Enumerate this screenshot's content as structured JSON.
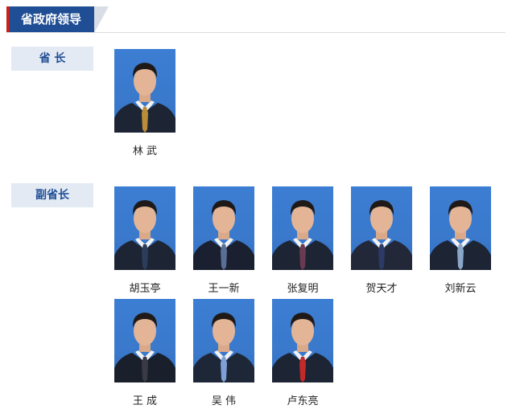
{
  "header": {
    "title": "省政府领导"
  },
  "sections": [
    {
      "label": "省 长"
    },
    {
      "label": "副省长"
    }
  ],
  "people": [
    {
      "name": "林 武",
      "tie": "#b98d3a",
      "suit": "#1d2433"
    },
    {
      "name": "胡玉亭",
      "tie": "#2c3d5c",
      "suit": "#1d2433"
    },
    {
      "name": "王一新",
      "tie": "#5a6f96",
      "suit": "#1a2030"
    },
    {
      "name": "张复明",
      "tie": "#6a3a50",
      "suit": "#1d2433"
    },
    {
      "name": "贺天才",
      "tie": "#2b3a66",
      "suit": "#222838"
    },
    {
      "name": "刘新云",
      "tie": "#8aa6c8",
      "suit": "#1d2433"
    },
    {
      "name": "王 成",
      "tie": "#3a3a44",
      "suit": "#1a1f2c"
    },
    {
      "name": "吴 伟",
      "tie": "#7ea0d8",
      "suit": "#1e2738"
    },
    {
      "name": "卢东亮",
      "tie": "#c02a2a",
      "suit": "#1d2433"
    }
  ]
}
